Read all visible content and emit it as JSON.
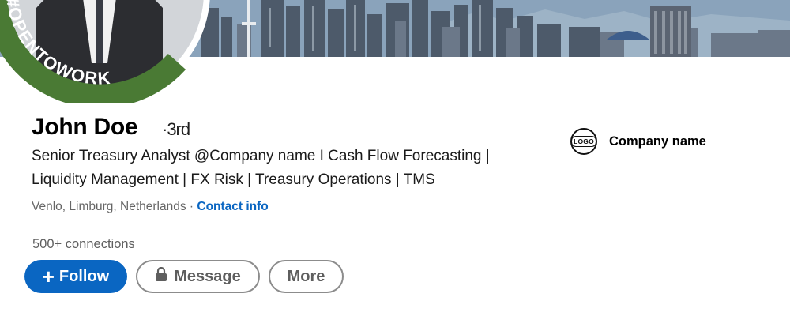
{
  "banner": {
    "hashtag": "#OPENTOWORK"
  },
  "profile": {
    "name": "John Doe",
    "degree": "·3rd",
    "headline_line1": "Senior Treasury Analyst @Company name I Cash Flow Forecasting |",
    "headline_line2": "Liquidity Management | FX Risk | Treasury Operations | TMS",
    "location": "Venlo, Limburg, Netherlands",
    "separator": " · ",
    "contact_link": "Contact info",
    "connections": "500+ connections"
  },
  "actions": {
    "follow_icon": "+",
    "follow_label": "Follow",
    "message_label": "Message",
    "more_label": "More"
  },
  "company": {
    "logo_text": "LOGO",
    "name": "Company name"
  },
  "colors": {
    "primary_blue": "#0a66c2",
    "open_to_work_green": "#4a7a34"
  },
  "icons": [
    "plus-icon",
    "lock-icon",
    "company-logo-icon"
  ]
}
